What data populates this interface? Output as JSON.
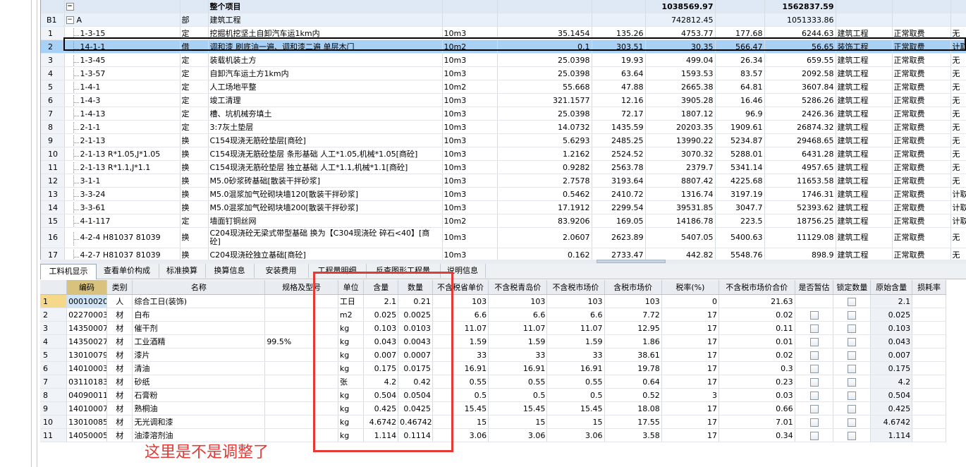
{
  "upper": {
    "total_row": {
      "label": "整个项目",
      "c7": "1038569.97",
      "c9": "1562837.59"
    },
    "b1_row": {
      "no": "B1",
      "code": "A",
      "type": "部",
      "name": "建筑工程",
      "c7": "742812.45",
      "c9": "1051333.86"
    },
    "rows": [
      {
        "no": "1",
        "code": "1-3-15",
        "type": "定",
        "name": "挖掘机挖坚土自卸汽车运1km内",
        "unit": "10m3",
        "qty": "35.1454",
        "p1": "135.26",
        "p2": "4753.77",
        "p3": "177.68",
        "p4": "6244.63",
        "prof": "建筑工程",
        "fee": "正常取费",
        "x": "无"
      },
      {
        "no": "2",
        "code": "14-1-1",
        "type": "借",
        "name": "调和漆 刷底油一遍、调和漆二遍 单层木门",
        "unit": "10m2",
        "qty": "0.1",
        "p1": "303.51",
        "p2": "30.35",
        "p3": "566.47",
        "p4": "56.65",
        "prof": "装饰工程",
        "fee": "正常取费",
        "x": "计取超"
      },
      {
        "no": "3",
        "code": "1-3-45",
        "type": "定",
        "name": "装载机装土方",
        "unit": "10m3",
        "qty": "25.0398",
        "p1": "19.93",
        "p2": "499.04",
        "p3": "26.34",
        "p4": "659.55",
        "prof": "建筑工程",
        "fee": "正常取费",
        "x": "无"
      },
      {
        "no": "4",
        "code": "1-3-57",
        "type": "定",
        "name": "自卸汽车运土方1km内",
        "unit": "10m3",
        "qty": "25.0398",
        "p1": "63.64",
        "p2": "1593.53",
        "p3": "83.57",
        "p4": "2092.58",
        "prof": "建筑工程",
        "fee": "正常取费",
        "x": "无"
      },
      {
        "no": "5",
        "code": "1-4-1",
        "type": "定",
        "name": "人工场地平整",
        "unit": "10m2",
        "qty": "55.668",
        "p1": "47.88",
        "p2": "2665.38",
        "p3": "64.81",
        "p4": "3607.84",
        "prof": "建筑工程",
        "fee": "正常取费",
        "x": "无"
      },
      {
        "no": "6",
        "code": "1-4-3",
        "type": "定",
        "name": "竣工清理",
        "unit": "10m3",
        "qty": "321.1577",
        "p1": "12.16",
        "p2": "3905.28",
        "p3": "16.46",
        "p4": "5286.26",
        "prof": "建筑工程",
        "fee": "正常取费",
        "x": "无"
      },
      {
        "no": "7",
        "code": "1-4-13",
        "type": "定",
        "name": "槽、坑机械夯填土",
        "unit": "10m3",
        "qty": "25.0398",
        "p1": "72.17",
        "p2": "1807.12",
        "p3": "96.9",
        "p4": "2426.36",
        "prof": "建筑工程",
        "fee": "正常取费",
        "x": "无"
      },
      {
        "no": "8",
        "code": "2-1-1",
        "type": "定",
        "name": "3:7灰土垫层",
        "unit": "10m3",
        "qty": "14.0732",
        "p1": "1435.59",
        "p2": "20203.35",
        "p3": "1909.61",
        "p4": "26874.32",
        "prof": "建筑工程",
        "fee": "正常取费",
        "x": "无"
      },
      {
        "no": "9",
        "code": "2-1-13",
        "type": "换",
        "name": "C154现浇无筋砼垫层[商砼]",
        "unit": "10m3",
        "qty": "5.6293",
        "p1": "2485.25",
        "p2": "13990.22",
        "p3": "5234.87",
        "p4": "29468.65",
        "prof": "建筑工程",
        "fee": "正常取费",
        "x": "无"
      },
      {
        "no": "10",
        "code": "2-1-13 R*1.05,J*1.05",
        "type": "换",
        "name": "C154现浇无筋砼垫层 条形基础 人工*1.05,机械*1.05[商砼]",
        "unit": "10m3",
        "qty": "1.2162",
        "p1": "2524.52",
        "p2": "3070.32",
        "p3": "5288.01",
        "p4": "6431.28",
        "prof": "建筑工程",
        "fee": "正常取费",
        "x": "无"
      },
      {
        "no": "11",
        "code": "2-1-13 R*1.1,J*1.1",
        "type": "换",
        "name": "C154现浇无筋砼垫层 独立基础 人工*1.1,机械*1.1[商砼]",
        "unit": "10m3",
        "qty": "0.9282",
        "p1": "2563.78",
        "p2": "2379.7",
        "p3": "5341.14",
        "p4": "4957.65",
        "prof": "建筑工程",
        "fee": "正常取费",
        "x": "无"
      },
      {
        "no": "12",
        "code": "3-1-1",
        "type": "换",
        "name": "M5.0砂浆砖基础[散装干拌砂浆]",
        "unit": "10m3",
        "qty": "2.7578",
        "p1": "3193.64",
        "p2": "8807.42",
        "p3": "4225.68",
        "p4": "11653.58",
        "prof": "建筑工程",
        "fee": "正常取费",
        "x": "无"
      },
      {
        "no": "13",
        "code": "3-3-24",
        "type": "换",
        "name": "M5.0混浆加气砼砌块墙120[散装干拌砂浆]",
        "unit": "10m3",
        "qty": "0.5462",
        "p1": "2410.72",
        "p2": "1316.74",
        "p3": "3197.19",
        "p4": "1746.31",
        "prof": "建筑工程",
        "fee": "正常取费",
        "x": "计取超"
      },
      {
        "no": "14",
        "code": "3-3-61",
        "type": "换",
        "name": "M5.0混浆加气砼砌块墙200[散装干拌砂浆]",
        "unit": "10m3",
        "qty": "17.1912",
        "p1": "2299.54",
        "p2": "39531.85",
        "p3": "3047.7",
        "p4": "52393.62",
        "prof": "建筑工程",
        "fee": "正常取费",
        "x": "计取超"
      },
      {
        "no": "15",
        "code": "4-1-117",
        "type": "定",
        "name": "墙面钉铜丝网",
        "unit": "10m2",
        "qty": "83.9206",
        "p1": "169.05",
        "p2": "14186.78",
        "p3": "223.5",
        "p4": "18756.25",
        "prof": "建筑工程",
        "fee": "正常取费",
        "x": "计取超"
      },
      {
        "no": "16",
        "code": "4-2-4 H81037 81039",
        "type": "换",
        "name": "C204现浇砼无梁式带型基础 换为【C304现浇砼 碎石<40】[商砼]",
        "unit": "10m3",
        "qty": "2.0607",
        "p1": "2623.89",
        "p2": "5407.05",
        "p3": "5400.63",
        "p4": "11129.08",
        "prof": "建筑工程",
        "fee": "正常取费",
        "x": "无",
        "tall": true
      },
      {
        "no": "17",
        "code": "4-2-7 H81037 81039",
        "type": "换",
        "name": "C204现浇砼独立基础[商砼]",
        "unit": "10m3",
        "qty": "0.162",
        "p1": "2733.47",
        "p2": "442.82",
        "p3": "5548.76",
        "p4": "898.9",
        "prof": "建筑工程",
        "fee": "正常取费",
        "x": "无"
      }
    ]
  },
  "tabs": [
    "工料机显示",
    "查看单价构成",
    "标准换算",
    "换算信息",
    "安装费用",
    "工程量明细",
    "反查图形工程量",
    "说明信息"
  ],
  "lower": {
    "headers": [
      "编码",
      "类别",
      "名称",
      "规格及型号",
      "单位",
      "含量",
      "数量",
      "不含税省单价",
      "不含税青岛价",
      "不含税市场价",
      "含税市场价",
      "税率(%)",
      "不含税市场价合价",
      "是否暂估",
      "锁定数量",
      "原始含量",
      "损耗率"
    ],
    "rows": [
      {
        "no": "1",
        "code": "00010020",
        "cat": "人",
        "name": "综合工日(装饰)",
        "spec": "",
        "unit": "工日",
        "content": "2.1",
        "qty": "0.21",
        "p1": "103",
        "p2": "103",
        "p3": "103",
        "p4": "103",
        "tax": "0",
        "total": "21.63",
        "orig": "2.1",
        "checks": false
      },
      {
        "no": "2",
        "code": "02270003",
        "cat": "材",
        "name": "白布",
        "spec": "",
        "unit": "m2",
        "content": "0.025",
        "qty": "0.0025",
        "p1": "6.6",
        "p2": "6.6",
        "p3": "6.6",
        "p4": "7.72",
        "tax": "17",
        "total": "0.02",
        "orig": "0.025",
        "checks": true
      },
      {
        "no": "3",
        "code": "14350007",
        "cat": "材",
        "name": "催干剂",
        "spec": "",
        "unit": "kg",
        "content": "0.103",
        "qty": "0.0103",
        "p1": "11.07",
        "p2": "11.07",
        "p3": "11.07",
        "p4": "12.95",
        "tax": "17",
        "total": "0.11",
        "orig": "0.103",
        "checks": true
      },
      {
        "no": "4",
        "code": "14350027",
        "cat": "材",
        "name": "工业酒精",
        "spec": "99.5%",
        "unit": "kg",
        "content": "0.043",
        "qty": "0.0043",
        "p1": "1.59",
        "p2": "1.59",
        "p3": "1.59",
        "p4": "1.86",
        "tax": "17",
        "total": "0.01",
        "orig": "0.043",
        "checks": true
      },
      {
        "no": "5",
        "code": "13010079",
        "cat": "材",
        "name": "漆片",
        "spec": "",
        "unit": "kg",
        "content": "0.007",
        "qty": "0.0007",
        "p1": "33",
        "p2": "33",
        "p3": "33",
        "p4": "38.61",
        "tax": "17",
        "total": "0.02",
        "orig": "0.007",
        "checks": true
      },
      {
        "no": "6",
        "code": "14010003",
        "cat": "材",
        "name": "清油",
        "spec": "",
        "unit": "kg",
        "content": "0.175",
        "qty": "0.0175",
        "p1": "16.91",
        "p2": "16.91",
        "p3": "16.91",
        "p4": "19.78",
        "tax": "17",
        "total": "0.3",
        "orig": "0.175",
        "checks": true
      },
      {
        "no": "7",
        "code": "03110183",
        "cat": "材",
        "name": "砂纸",
        "spec": "",
        "unit": "张",
        "content": "4.2",
        "qty": "0.42",
        "p1": "0.55",
        "p2": "0.55",
        "p3": "0.55",
        "p4": "0.64",
        "tax": "17",
        "total": "0.23",
        "orig": "4.2",
        "checks": true
      },
      {
        "no": "8",
        "code": "04090011",
        "cat": "材",
        "name": "石膏粉",
        "spec": "",
        "unit": "kg",
        "content": "0.504",
        "qty": "0.0504",
        "p1": "0.5",
        "p2": "0.5",
        "p3": "0.5",
        "p4": "0.52",
        "tax": "3",
        "total": "0.03",
        "orig": "0.504",
        "checks": true
      },
      {
        "no": "9",
        "code": "14010007",
        "cat": "材",
        "name": "熟桐油",
        "spec": "",
        "unit": "kg",
        "content": "0.425",
        "qty": "0.0425",
        "p1": "15.45",
        "p2": "15.45",
        "p3": "15.45",
        "p4": "18.08",
        "tax": "17",
        "total": "0.66",
        "orig": "0.425",
        "checks": true
      },
      {
        "no": "10",
        "code": "13010085",
        "cat": "材",
        "name": "无光调和漆",
        "spec": "",
        "unit": "kg",
        "content": "4.6742",
        "qty": "0.46742",
        "p1": "15",
        "p2": "15",
        "p3": "15",
        "p4": "17.55",
        "tax": "17",
        "total": "7.01",
        "orig": "4.6742",
        "checks": true
      },
      {
        "no": "11",
        "code": "14050005",
        "cat": "材",
        "name": "油漆溶剂油",
        "spec": "",
        "unit": "kg",
        "content": "1.114",
        "qty": "0.1114",
        "p1": "3.06",
        "p2": "3.06",
        "p3": "3.06",
        "p4": "3.58",
        "tax": "17",
        "total": "0.34",
        "orig": "1.114",
        "checks": true
      }
    ]
  },
  "annotation": "这里是不是调整了",
  "colors": {
    "selected_row": "#a9d1f5",
    "annotation_red": "#e53935",
    "header_gold": "#d9c27d"
  }
}
